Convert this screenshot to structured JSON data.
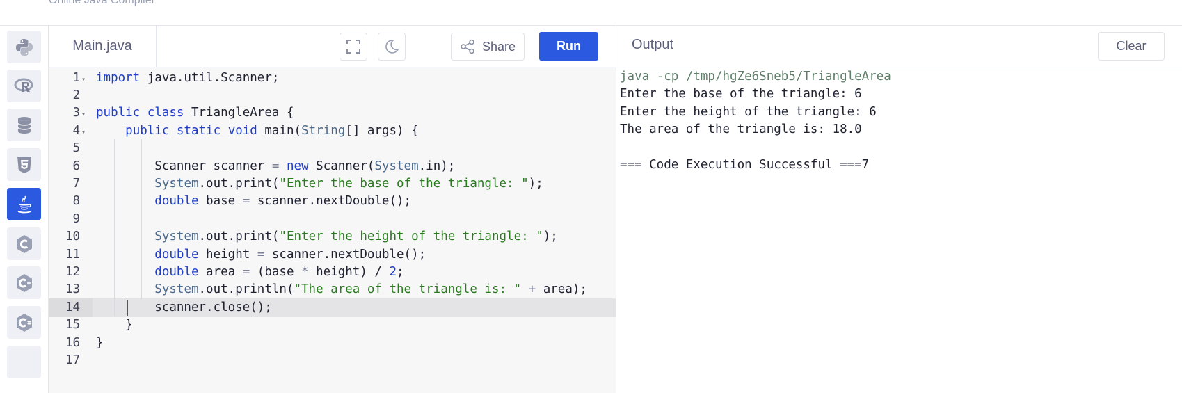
{
  "header": {
    "brand": "Online Java Compiler"
  },
  "sidebar": {
    "items": [
      {
        "icon": "python-icon",
        "active": false
      },
      {
        "icon": "r-lang-icon",
        "active": false
      },
      {
        "icon": "database-icon",
        "active": false
      },
      {
        "icon": "html5-icon",
        "active": false
      },
      {
        "icon": "java-icon",
        "active": true
      },
      {
        "icon": "c-lang-icon",
        "active": false
      },
      {
        "icon": "cpp-icon",
        "active": false
      },
      {
        "icon": "csharp-icon",
        "active": false
      }
    ]
  },
  "editor": {
    "file_name": "Main.java",
    "share_label": "Share",
    "run_label": "Run",
    "current_line": 14,
    "lines": [
      {
        "num": "1",
        "fold": true
      },
      {
        "num": "2",
        "fold": false
      },
      {
        "num": "3",
        "fold": true
      },
      {
        "num": "4",
        "fold": true
      },
      {
        "num": "5",
        "fold": false
      },
      {
        "num": "6",
        "fold": false
      },
      {
        "num": "7",
        "fold": false
      },
      {
        "num": "8",
        "fold": false
      },
      {
        "num": "9",
        "fold": false
      },
      {
        "num": "10",
        "fold": false
      },
      {
        "num": "11",
        "fold": false
      },
      {
        "num": "12",
        "fold": false
      },
      {
        "num": "13",
        "fold": false
      },
      {
        "num": "14",
        "fold": false
      },
      {
        "num": "15",
        "fold": false
      },
      {
        "num": "16",
        "fold": false
      },
      {
        "num": "17",
        "fold": false
      }
    ],
    "code": [
      [
        {
          "t": "kw",
          "s": "import"
        },
        {
          "t": "",
          "s": " java.util.Scanner;"
        }
      ],
      [],
      [
        {
          "t": "kw",
          "s": "public"
        },
        {
          "t": "",
          "s": " "
        },
        {
          "t": "kw",
          "s": "class"
        },
        {
          "t": "",
          "s": " TriangleArea {"
        }
      ],
      [
        {
          "t": "",
          "s": "    "
        },
        {
          "t": "kw",
          "s": "public"
        },
        {
          "t": "",
          "s": " "
        },
        {
          "t": "kw",
          "s": "static"
        },
        {
          "t": "",
          "s": " "
        },
        {
          "t": "kw",
          "s": "void"
        },
        {
          "t": "",
          "s": " main("
        },
        {
          "t": "ty",
          "s": "String"
        },
        {
          "t": "",
          "s": "[] args) {"
        }
      ],
      [],
      [
        {
          "t": "",
          "s": "        Scanner scanner "
        },
        {
          "t": "op",
          "s": "="
        },
        {
          "t": "",
          "s": " "
        },
        {
          "t": "kw",
          "s": "new"
        },
        {
          "t": "",
          "s": " Scanner("
        },
        {
          "t": "ty",
          "s": "System"
        },
        {
          "t": "",
          "s": ".in);"
        }
      ],
      [
        {
          "t": "",
          "s": "        "
        },
        {
          "t": "ty",
          "s": "System"
        },
        {
          "t": "",
          "s": ".out.print("
        },
        {
          "t": "str",
          "s": "\"Enter the base of the triangle: \""
        },
        {
          "t": "",
          "s": ");"
        }
      ],
      [
        {
          "t": "",
          "s": "        "
        },
        {
          "t": "kw",
          "s": "double"
        },
        {
          "t": "",
          "s": " base "
        },
        {
          "t": "op",
          "s": "="
        },
        {
          "t": "",
          "s": " scanner.nextDouble();"
        }
      ],
      [],
      [
        {
          "t": "",
          "s": "        "
        },
        {
          "t": "ty",
          "s": "System"
        },
        {
          "t": "",
          "s": ".out.print("
        },
        {
          "t": "str",
          "s": "\"Enter the height of the triangle: \""
        },
        {
          "t": "",
          "s": ");"
        }
      ],
      [
        {
          "t": "",
          "s": "        "
        },
        {
          "t": "kw",
          "s": "double"
        },
        {
          "t": "",
          "s": " height "
        },
        {
          "t": "op",
          "s": "="
        },
        {
          "t": "",
          "s": " scanner.nextDouble();"
        }
      ],
      [
        {
          "t": "",
          "s": "        "
        },
        {
          "t": "kw",
          "s": "double"
        },
        {
          "t": "",
          "s": " area "
        },
        {
          "t": "op",
          "s": "="
        },
        {
          "t": "",
          "s": " (base "
        },
        {
          "t": "op",
          "s": "*"
        },
        {
          "t": "",
          "s": " height) / "
        },
        {
          "t": "num",
          "s": "2"
        },
        {
          "t": "",
          "s": ";"
        }
      ],
      [
        {
          "t": "",
          "s": "        "
        },
        {
          "t": "ty",
          "s": "System"
        },
        {
          "t": "",
          "s": ".out.println("
        },
        {
          "t": "str",
          "s": "\"The area of the triangle is: \""
        },
        {
          "t": "",
          "s": " "
        },
        {
          "t": "op",
          "s": "+"
        },
        {
          "t": "",
          "s": " area);"
        }
      ],
      [
        {
          "t": "",
          "s": "        scanner.close();"
        }
      ],
      [
        {
          "t": "",
          "s": "    }"
        }
      ],
      [
        {
          "t": "",
          "s": "}"
        }
      ],
      []
    ]
  },
  "output": {
    "title": "Output",
    "clear_label": "Clear",
    "command": "java -cp /tmp/hgZe6Sneb5/TriangleArea",
    "lines": [
      "Enter the base of the triangle: 6",
      "Enter the height of the triangle: 6",
      "The area of the triangle is: 18.0",
      "",
      "=== Code Execution Successful ===7"
    ]
  },
  "colors": {
    "accent": "#2b59e0",
    "string": "#2a7a1f",
    "keyword": "#1f3ec8"
  }
}
